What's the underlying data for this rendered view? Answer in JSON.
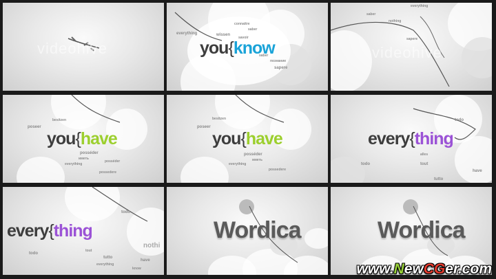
{
  "watermark": "videohive",
  "frames": [
    {
      "id": 1,
      "words": []
    },
    {
      "id": 2,
      "title_a": "you",
      "title_brace": "{",
      "title_b": "know",
      "words": [
        "wissen",
        "saber",
        "everything",
        "connaitre",
        "savoir",
        "saber",
        "sapere",
        "познание"
      ]
    },
    {
      "id": 3,
      "words": [
        "everything",
        "saber",
        "sapere",
        "nothing"
      ]
    },
    {
      "id": 4,
      "title_a": "you",
      "title_brace": "{",
      "title_b": "have",
      "words": [
        "poseer",
        "besitzen",
        "posséder",
        "everything",
        "posséder",
        "possedere",
        "иметь"
      ]
    },
    {
      "id": 5,
      "title_a": "you",
      "title_brace": "{",
      "title_b": "have",
      "words": [
        "poseer",
        "besitzen",
        "posséder",
        "everything",
        "possedere",
        "иметь"
      ]
    },
    {
      "id": 6,
      "title_a": "every",
      "title_brace": "{",
      "title_b": "thing",
      "words": [
        "todo",
        "todo",
        "tout",
        "alles",
        "have",
        "tutto"
      ]
    },
    {
      "id": 7,
      "title_a": "every",
      "title_brace": "{",
      "title_b": "thing",
      "words": [
        "todo",
        "nothi",
        "todo",
        "tout",
        "have",
        "everything",
        "tutto",
        "know"
      ]
    },
    {
      "id": 8,
      "brand": "Wordica"
    },
    {
      "id": 9,
      "brand": "Wordica"
    }
  ],
  "logo": {
    "prefix": "www.",
    "n": "N",
    "ew": "ew",
    "c": "CG",
    "suffix": "er.com"
  }
}
